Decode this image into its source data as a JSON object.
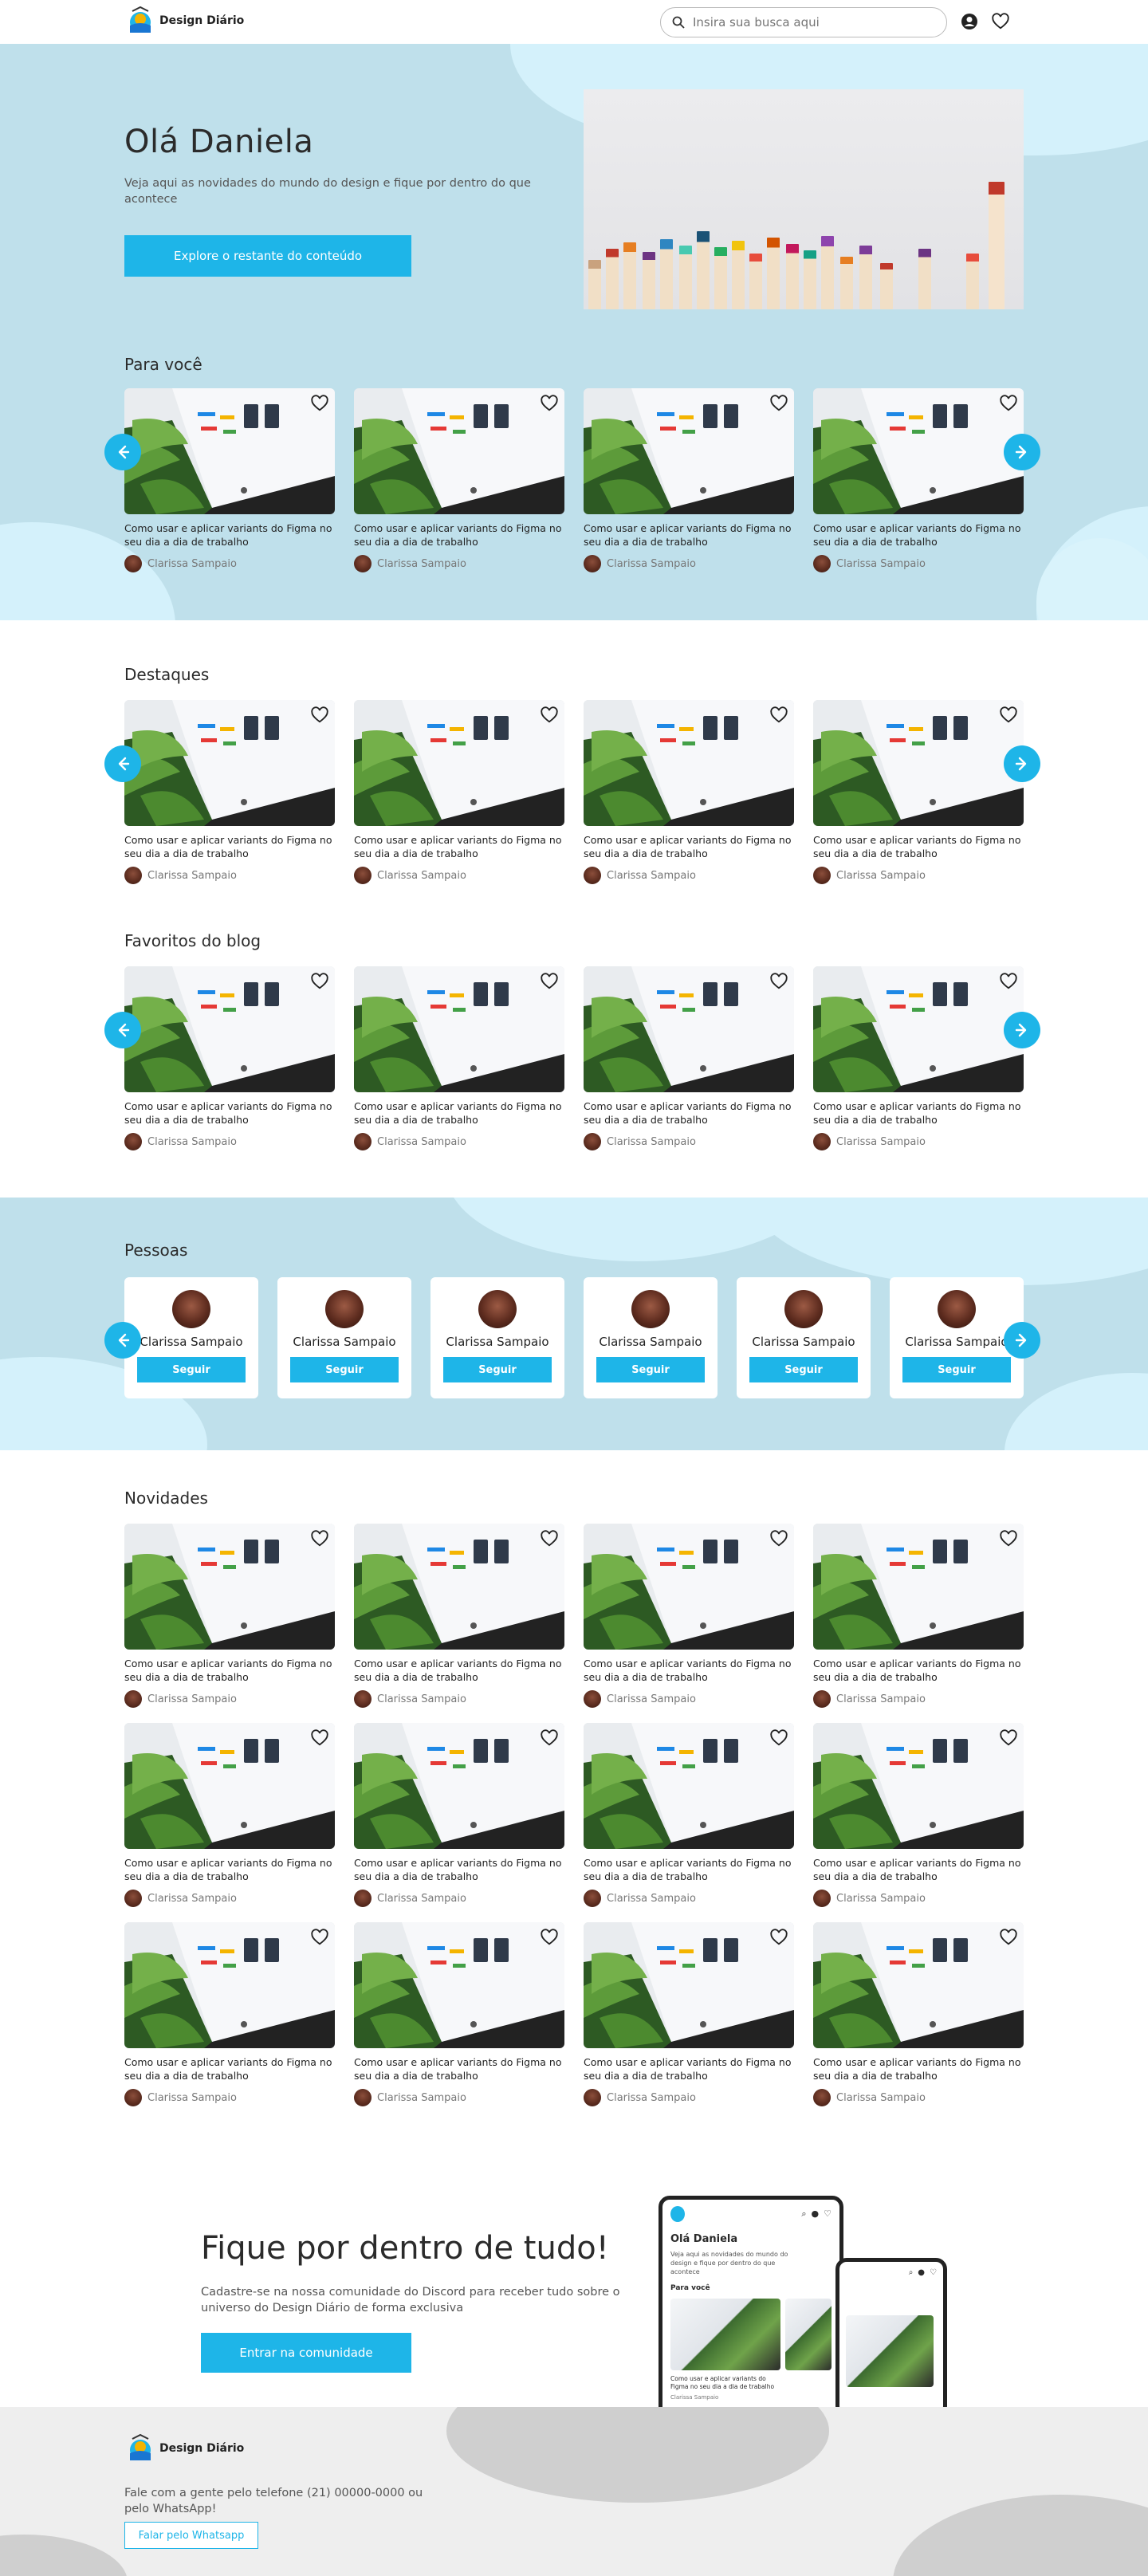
{
  "header": {
    "brand": "Design Diário",
    "search_placeholder": "Insira sua busca aqui"
  },
  "hero": {
    "title": "Olá Daniela",
    "subtitle": "Veja aqui as novidades do mundo do design e fique por dentro do que acontece",
    "button": "Explore o restante do conteúdo"
  },
  "sections": {
    "para_voce": "Para você",
    "destaques": "Destaques",
    "favoritos": "Favoritos do blog",
    "pessoas": "Pessoas",
    "novidades": "Novidades"
  },
  "card": {
    "title": "Como usar e aplicar variants do Figma no seu dia a dia de trabalho",
    "author": "Clarissa Sampaio"
  },
  "people": {
    "name": "Clarissa Sampaio",
    "follow_label": "Seguir"
  },
  "cta": {
    "title": "Fique por dentro de tudo!",
    "subtitle": "Cadastre-se na nossa comunidade do Discord para receber tudo sobre o universo do Design Diário de forma exclusiva",
    "button": "Entrar na comunidade"
  },
  "mockup": {
    "title": "Olá Daniela",
    "subtitle": "Veja aqui as novidades do mundo do design e fique por dentro do que acontece",
    "section": "Para você",
    "card_title": "Como usar e aplicar variants do Figma no seu dia a dia de trabalho",
    "author": "Clarissa Sampaio"
  },
  "footer": {
    "brand": "Design Diário",
    "contact": "Fale com a gente pelo telefone (21) 00000-0000 ou pelo WhatsApp!",
    "button": "Falar pelo Whatsapp"
  },
  "colors": {
    "accent": "#1eb5e8",
    "hero_bg": "#bfe0eb",
    "blob": "#d4f1fb",
    "footer_bg": "#eeeeee"
  }
}
